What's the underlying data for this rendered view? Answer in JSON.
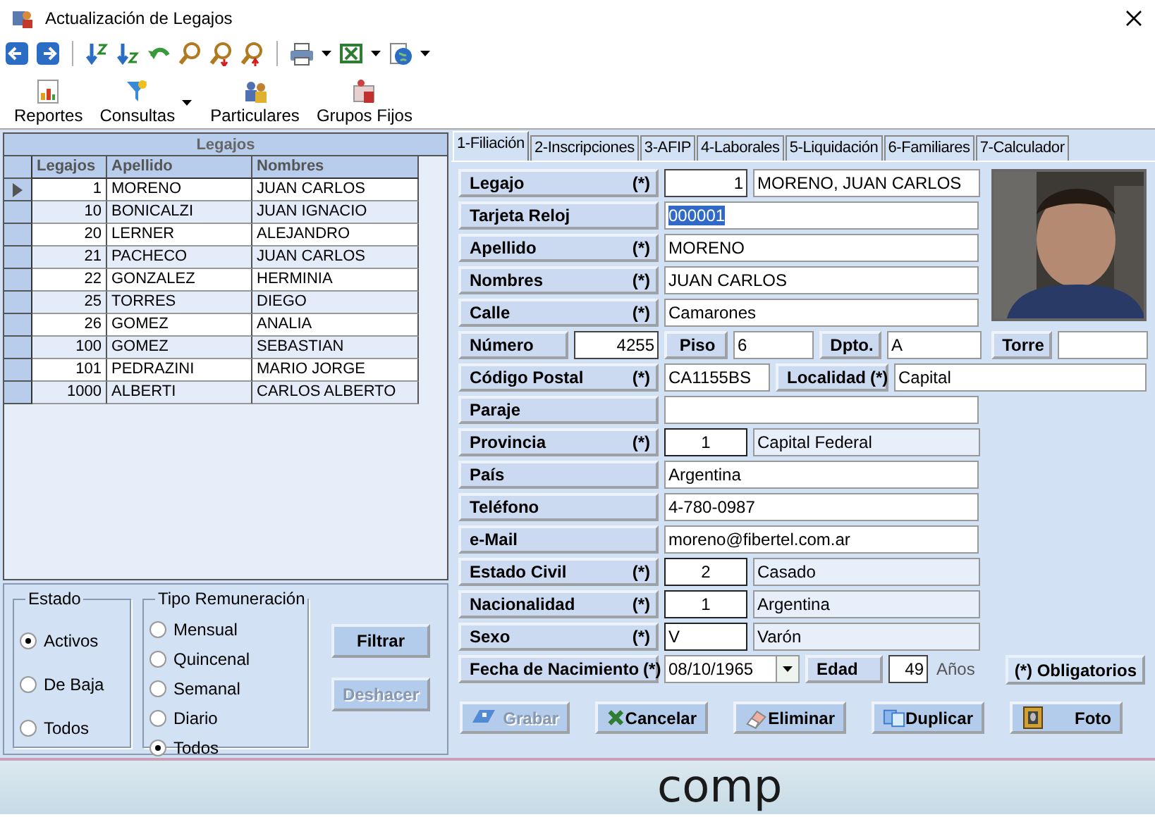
{
  "window": {
    "title": "Actualización de Legajos"
  },
  "commands": [
    {
      "label": "Reportes",
      "kind": "report",
      "dropdown": false
    },
    {
      "label": "Consultas",
      "kind": "query",
      "dropdown": true
    },
    {
      "label": "Particulares",
      "kind": "people",
      "dropdown": false
    },
    {
      "label": "Grupos Fijos",
      "kind": "group",
      "dropdown": false
    }
  ],
  "grid": {
    "title": "Legajos",
    "columns": [
      "Legajos",
      "Apellido",
      "Nombres"
    ],
    "rows": [
      {
        "cells": [
          "1",
          "MORENO",
          "JUAN CARLOS"
        ],
        "selected": true
      },
      {
        "cells": [
          "10",
          "BONICALZI",
          "JUAN IGNACIO"
        ],
        "selected": false
      },
      {
        "cells": [
          "20",
          "LERNER",
          "ALEJANDRO"
        ],
        "selected": false
      },
      {
        "cells": [
          "21",
          "PACHECO",
          "JUAN CARLOS"
        ],
        "selected": false
      },
      {
        "cells": [
          "22",
          "GONZALEZ",
          "HERMINIA"
        ],
        "selected": false
      },
      {
        "cells": [
          "25",
          "TORRES",
          "DIEGO"
        ],
        "selected": false
      },
      {
        "cells": [
          "26",
          "GOMEZ",
          "ANALIA"
        ],
        "selected": false
      },
      {
        "cells": [
          "100",
          "GOMEZ",
          "SEBASTIAN"
        ],
        "selected": false
      },
      {
        "cells": [
          "101",
          "PEDRAZINI",
          "MARIO JORGE"
        ],
        "selected": false
      },
      {
        "cells": [
          "1000",
          "ALBERTI",
          "CARLOS ALBERTO"
        ],
        "selected": false
      }
    ]
  },
  "filters": {
    "groups": [
      {
        "title": "Estado",
        "options": [
          {
            "label": "Activos",
            "selected": true
          },
          {
            "label": "De Baja",
            "selected": false
          },
          {
            "label": "Todos",
            "selected": false
          }
        ]
      },
      {
        "title": "Tipo Remuneración",
        "options": [
          {
            "label": "Mensual",
            "selected": false
          },
          {
            "label": "Quincenal",
            "selected": false
          },
          {
            "label": "Semanal",
            "selected": false
          },
          {
            "label": "Diario",
            "selected": false
          },
          {
            "label": "Todos",
            "selected": true
          }
        ]
      }
    ],
    "buttons": [
      {
        "label": "Filtrar",
        "disabled": false
      },
      {
        "label": "Deshacer",
        "disabled": true
      }
    ]
  },
  "tabs": [
    {
      "label": "1-Filiación",
      "selected": true
    },
    {
      "label": "2-Inscripciones",
      "selected": false
    },
    {
      "label": "3-AFIP",
      "selected": false
    },
    {
      "label": "4-Laborales",
      "selected": false
    },
    {
      "label": "5-Liquidación",
      "selected": false
    },
    {
      "label": "6-Familiares",
      "selected": false
    },
    {
      "label": "7-Calculador",
      "selected": false
    }
  ],
  "form": {
    "rows": [
      {
        "kind": "code",
        "cells": [
          {
            "kind": "label",
            "text": "Legajo",
            "required_mark": "(*)"
          },
          {
            "kind": "number",
            "value": "1"
          },
          {
            "kind": "text",
            "value": "MORENO, JUAN CARLOS"
          }
        ]
      },
      {
        "kind": "text",
        "cells": [
          {
            "kind": "label",
            "text": "Tarjeta Reloj"
          },
          {
            "kind": "highlighted",
            "value": "000001"
          }
        ]
      },
      {
        "kind": "text",
        "cells": [
          {
            "kind": "label",
            "text": "Apellido",
            "required_mark": "(*)"
          },
          {
            "kind": "text",
            "value": "MORENO"
          }
        ]
      },
      {
        "kind": "text",
        "cells": [
          {
            "kind": "label",
            "text": "Nombres",
            "required_mark": "(*)"
          },
          {
            "kind": "text",
            "value": "JUAN CARLOS"
          }
        ]
      },
      {
        "kind": "text",
        "cells": [
          {
            "kind": "label",
            "text": "Calle",
            "required_mark": "(*)"
          },
          {
            "kind": "text",
            "value": "Camarones"
          }
        ]
      },
      {
        "kind": "address",
        "pairs": [
          {
            "label": "Número",
            "kind": "number",
            "value": "4255"
          },
          {
            "label": "Piso",
            "kind": "text",
            "value": "6"
          },
          {
            "label": "Dpto.",
            "kind": "text",
            "value": "A"
          },
          {
            "label": "Torre",
            "kind": "text"
          }
        ]
      },
      {
        "kind": "postal",
        "cells": [
          {
            "kind": "label",
            "text": "Código Postal",
            "required_mark": "(*)"
          },
          {
            "kind": "text",
            "value": "CA1155BS"
          },
          {
            "kind": "label",
            "text": "Localidad",
            "required_mark": "(*)"
          },
          {
            "kind": "text",
            "value": "Capital"
          }
        ]
      },
      {
        "kind": "text",
        "cells": [
          {
            "kind": "label",
            "text": "Paraje"
          },
          {
            "kind": "text"
          }
        ]
      },
      {
        "kind": "code",
        "cells": [
          {
            "kind": "label",
            "text": "Provincia",
            "required_mark": "(*)"
          },
          {
            "kind": "code",
            "value": "1"
          },
          {
            "kind": "readonly",
            "value": "Capital Federal"
          }
        ]
      },
      {
        "kind": "text",
        "cells": [
          {
            "kind": "label",
            "text": "País"
          },
          {
            "kind": "text",
            "value": "Argentina"
          }
        ]
      },
      {
        "kind": "text",
        "cells": [
          {
            "kind": "label",
            "text": "Teléfono"
          },
          {
            "kind": "text",
            "value": "4-780-0987"
          }
        ]
      },
      {
        "kind": "text",
        "cells": [
          {
            "kind": "label",
            "text": "e-Mail"
          },
          {
            "kind": "text",
            "value": "moreno@fibertel.com.ar"
          }
        ]
      },
      {
        "kind": "code",
        "cells": [
          {
            "kind": "label",
            "text": "Estado Civil",
            "required_mark": "(*)"
          },
          {
            "kind": "code",
            "value": "2"
          },
          {
            "kind": "readonly",
            "value": "Casado"
          }
        ]
      },
      {
        "kind": "code",
        "cells": [
          {
            "kind": "label",
            "text": "Nacionalidad",
            "required_mark": "(*)"
          },
          {
            "kind": "code",
            "value": "1"
          },
          {
            "kind": "readonly",
            "value": "Argentina"
          }
        ]
      },
      {
        "kind": "code",
        "cells": [
          {
            "kind": "label",
            "text": "Sexo",
            "required_mark": "(*)"
          },
          {
            "kind": "code-left",
            "value": "V"
          },
          {
            "kind": "readonly",
            "value": "Varón"
          }
        ]
      },
      {
        "kind": "date",
        "cells": [
          {
            "kind": "label",
            "text": "Fecha de Nacimiento",
            "required_mark": "(*)"
          },
          {
            "kind": "date",
            "value": "08/10/1965"
          },
          {
            "kind": "label",
            "text": "Edad"
          },
          {
            "kind": "number",
            "value": "49"
          },
          {
            "kind": "unit",
            "text": "Años"
          },
          {
            "kind": "button",
            "text": "(*) Obligatorios"
          }
        ]
      }
    ]
  },
  "actions": [
    {
      "label": "Grabar",
      "kind": "save",
      "disabled": true
    },
    {
      "label": "Cancelar",
      "kind": "cancel",
      "disabled": false
    },
    {
      "label": "Eliminar",
      "kind": "erase",
      "disabled": false
    },
    {
      "label": "Duplicar",
      "kind": "copy",
      "disabled": false
    },
    {
      "label": "Foto",
      "disabled": false
    }
  ],
  "background": {
    "text": "comp"
  }
}
